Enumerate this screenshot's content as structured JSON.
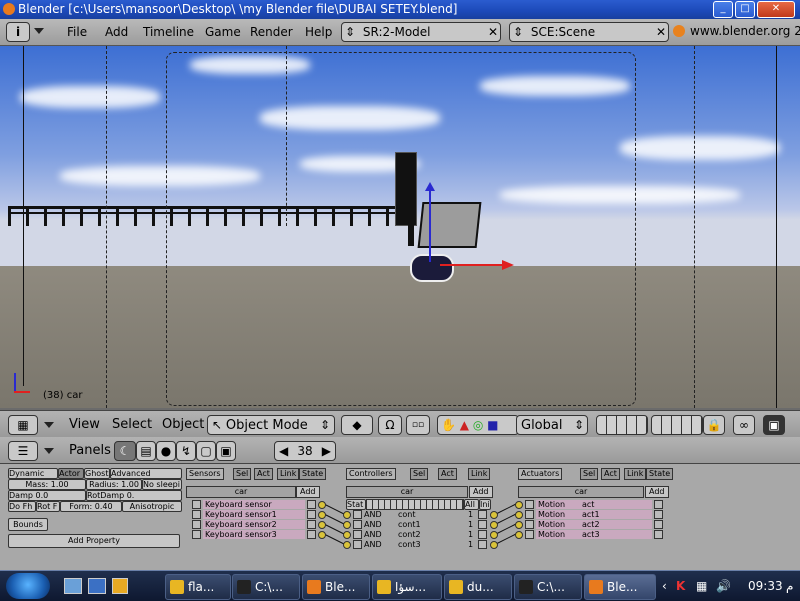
{
  "window": {
    "title": "Blender [c:\\Users\\mansoor\\Desktop\\  \\my Blender file\\DUBAI SETEY.blend]",
    "buttons": {
      "minimize": "_",
      "maximize": "□",
      "close": "✕"
    }
  },
  "menubar": {
    "info_icon": "i",
    "items": [
      "File",
      "Add",
      "Timeline",
      "Game",
      "Render",
      "Help"
    ],
    "screen_field": "SR:2-Model",
    "scene_field": "SCE:Scene",
    "link": "www.blender.org 2"
  },
  "viewport": {
    "overlay_text": "(38) car"
  },
  "view_header": {
    "menus": [
      "View",
      "Select",
      "Object"
    ],
    "mode": "Object Mode",
    "orientation": "Global"
  },
  "buttons_header": {
    "panels_label": "Panels",
    "frame": "38"
  },
  "physics": {
    "dynamic": "Dynamic",
    "actor": "Actor",
    "ghost": "Ghost",
    "advanced": "Advanced Settings",
    "mass": "Mass: 1.00",
    "radius": "Radius: 1.00",
    "no_sleep": "No sleepi",
    "damp": "Damp 0.0",
    "rotdamp": "RotDamp 0.",
    "do_fh": "Do Fh",
    "rot_fh": "Rot F",
    "form": "Form: 0.40",
    "aniso": "Anisotropic",
    "bounds": "Bounds",
    "add_property": "Add Property"
  },
  "sensors": {
    "title": "Sensors",
    "tabs": [
      "Sel",
      "Act",
      "Link",
      "State"
    ],
    "object": "car",
    "add": "Add",
    "items": [
      "Keyboard  sensor",
      "Keyboard  sensor1",
      "Keyboard  sensor2",
      "Keyboard  sensor3"
    ]
  },
  "controllers": {
    "title": "Controllers",
    "tabs": [
      "Sel",
      "Act",
      "Link"
    ],
    "object": "car",
    "add": "Add",
    "state_label": "Stat",
    "all_label": "All",
    "ini_label": "Ini",
    "items": [
      {
        "type": "AND",
        "name": "cont",
        "state": "1"
      },
      {
        "type": "AND",
        "name": "cont1",
        "state": "1"
      },
      {
        "type": "AND",
        "name": "cont2",
        "state": "1"
      },
      {
        "type": "AND",
        "name": "cont3",
        "state": "1"
      }
    ]
  },
  "actuators": {
    "title": "Actuators",
    "tabs": [
      "Sel",
      "Act",
      "Link",
      "State"
    ],
    "object": "car",
    "add": "Add",
    "items": [
      {
        "type": "Motion",
        "name": "act"
      },
      {
        "type": "Motion",
        "name": "act1"
      },
      {
        "type": "Motion",
        "name": "act2"
      },
      {
        "type": "Motion",
        "name": "act3"
      }
    ]
  },
  "taskbar": {
    "items": [
      "fla...",
      "C:\\...",
      "Ble...",
      "سؤا...",
      "du...",
      "C:\\...",
      "Ble..."
    ],
    "time": "09:33",
    "ampm": "م"
  },
  "colors": {
    "titlebar": "#1c49b8",
    "sky_top": "#3d6fd3",
    "ground": "#8f8a7f",
    "panel_bg": "#a8a8a8",
    "brick": "#c9a9bf",
    "taskbar": "#0e1830"
  }
}
